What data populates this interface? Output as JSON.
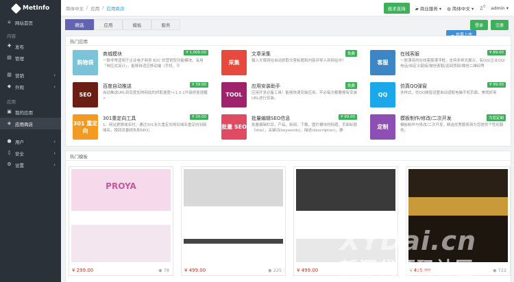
{
  "brand": "MetInfo",
  "sidebar": {
    "home": "网站首页",
    "sec_content": "内容",
    "publish": "发布",
    "manage": "管理",
    "marketing": "营销",
    "appearance": "外观",
    "sec_app": "应用",
    "my_apps": "我的应用",
    "app_store": "应用商店",
    "users": "用户",
    "security": "安全",
    "settings": "设置"
  },
  "breadcrumb": [
    "简体中文",
    "/",
    "应用",
    "/",
    "应用商店"
  ],
  "topbar": {
    "support": "技术支持",
    "business": "商业服务",
    "lang": "简体中文",
    "notify": "0",
    "user": "admin"
  },
  "tabs": [
    "精选",
    "应用",
    "模板",
    "服务"
  ],
  "actions": {
    "login": "登录",
    "register": "注册",
    "upload": "我要上传"
  },
  "hot_apps_title": "热门应用",
  "apps": [
    {
      "name": "商城模块",
      "desc": "一款非常适用于企业电子商务 B2C 的营销型功能模块。采用「响应式设计」，能够自适应移动端（手机、平",
      "price": "¥ 1,000.00",
      "thumb": "购物袋",
      "color": "#7bc3d8"
    },
    {
      "name": "文章采集",
      "desc": "输入文章网址自动抓取文章标题和内容并导入到网站中！",
      "price": "免费",
      "thumb": "采集",
      "color": "#e8493d"
    },
    {
      "name": "在线客服",
      "desc": "一款漂亮的在线客服漂浮框，支持多样式展示，有QQ/企业QQ/ 电话/自定义链接/微信客服/返回顶部/微信二维码等",
      "price": "¥ 89.00",
      "thumb": "客服",
      "color": "#3d86c6"
    },
    {
      "name": "百度自动推送",
      "desc": "自动推送URL到百度加快网站的抓取速度!<1.0.1升级修复提醒>",
      "price": "¥ 39.00",
      "thumb": "SEO",
      "color": "#6b1f12"
    },
    {
      "name": "应用安装助手",
      "desc": "应用开发必备工具！能够快速安装应用，不必每次都要拥有安装URL进行安装。",
      "price": "免费",
      "thumb": "TOOL",
      "color": "#a0226c"
    },
    {
      "name": "仿真QQ弹窗",
      "desc": "多样式，仿QQ弹窗设置自动适配电脑手机页面，美观好用",
      "price": "¥ 99.00",
      "thumb": "QQ",
      "color": "#1aa8ea"
    },
    {
      "name": "301重定向工具",
      "desc": "1、网站更换域名时，通过301永久重定向将旧域名重定向到新域名，挽回流量损失和SEO；",
      "price": "¥ 20.00",
      "thumb": "301 重定向",
      "color": "#f39a25"
    },
    {
      "name": "批量编辑SEO信息",
      "desc": "批量编辑栏目，产品，新闻，下载，图片模块的标题，页面标题（title），关键词(keywords)，描述(description)，静",
      "price": "¥ 99.00",
      "thumb": "批量 SEO",
      "color": "#e04a63"
    },
    {
      "name": "模板制作/修改/二次开发",
      "desc": "模板制作与修改/二次开发，精选优秀服务商为您提供个性化服务。",
      "price": "为您定制",
      "thumb": "定制",
      "color": "#8e4fb5"
    }
  ],
  "hot_templates_title": "热门模板",
  "templates": [
    {
      "price": "¥ 299.00",
      "views": "78",
      "brand": "PROYA"
    },
    {
      "price": "¥ 499.00",
      "views": "225",
      "brand": ""
    },
    {
      "price": "¥ 499.00",
      "views": "",
      "brand": ""
    },
    {
      "price": "¥ 499.00",
      "views": "722",
      "brand": ""
    }
  ],
  "watermark": {
    "line1": "XYDai.cn",
    "line2": "新源代源码社区"
  }
}
